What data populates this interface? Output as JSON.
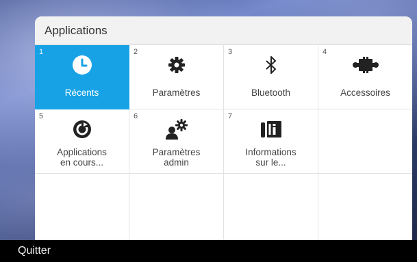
{
  "header": {
    "title": "Applications"
  },
  "apps": [
    {
      "number": "1",
      "label": "Récents",
      "icon": "clock-icon",
      "active": true
    },
    {
      "number": "2",
      "label": "Paramètres",
      "icon": "gear-icon"
    },
    {
      "number": "3",
      "label": "Bluetooth",
      "icon": "bluetooth-icon"
    },
    {
      "number": "4",
      "label": "Accessoires",
      "icon": "puzzle-icon"
    },
    {
      "number": "5",
      "label_line1": "Applications",
      "label_line2": "en cours...",
      "icon": "running-apps-icon"
    },
    {
      "number": "6",
      "label_line1": "Paramètres",
      "label_line2": "admin",
      "icon": "admin-settings-icon"
    },
    {
      "number": "7",
      "label_line1": "Informations",
      "label_line2": "sur le...",
      "icon": "phone-info-icon"
    }
  ],
  "footer": {
    "exit_label": "Quitter"
  },
  "colors": {
    "active": "#17a2e6",
    "footer": "#000000"
  }
}
